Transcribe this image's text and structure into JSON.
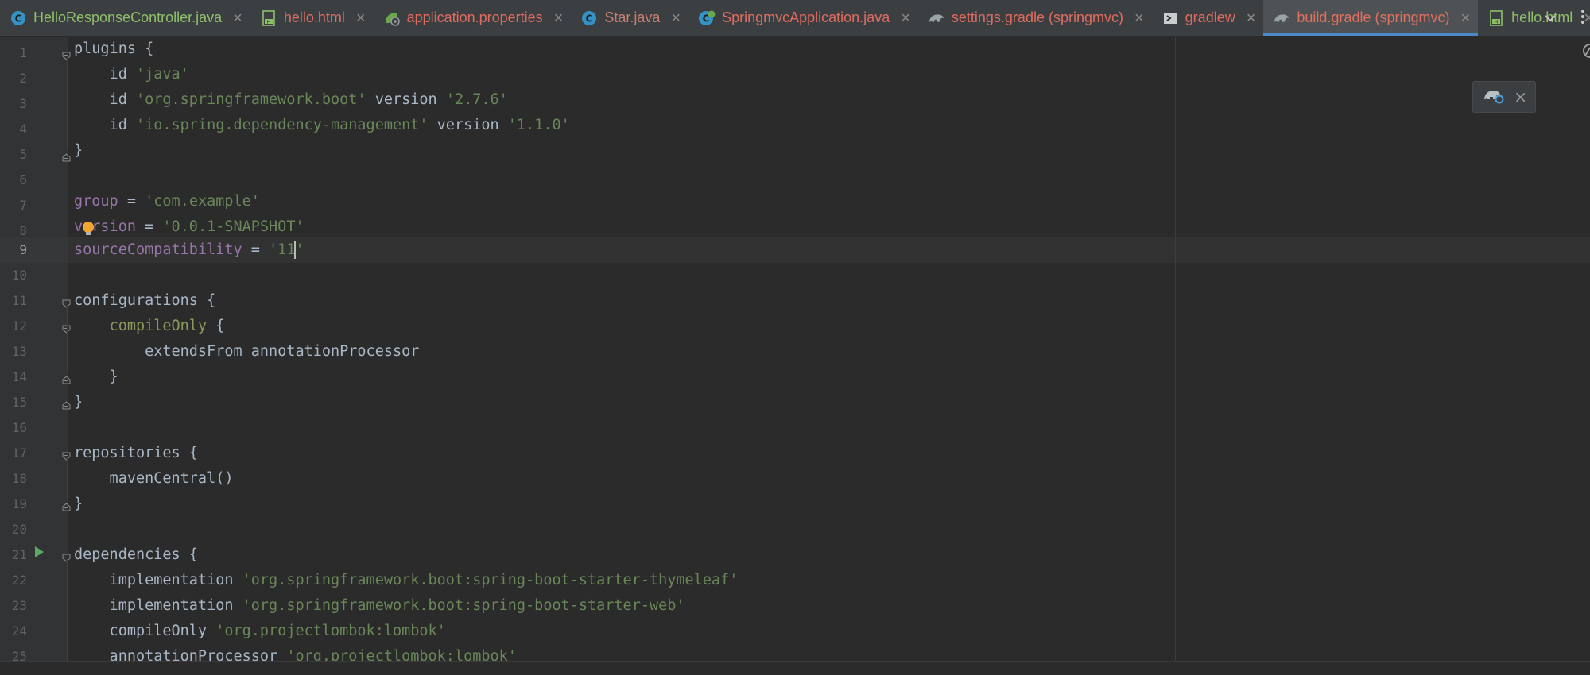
{
  "tabs": [
    {
      "label": "HelloResponseController.java",
      "icon": "java-class-icon",
      "color": "green"
    },
    {
      "label": "hello.html",
      "icon": "html-file-icon",
      "color": "red"
    },
    {
      "label": "application.properties",
      "icon": "spring-properties-icon",
      "color": "red"
    },
    {
      "label": "Star.java",
      "icon": "java-class-icon",
      "color": "blue"
    },
    {
      "label": "SpringmvcApplication.java",
      "icon": "spring-boot-class-icon",
      "color": "red"
    },
    {
      "label": "settings.gradle (springmvc)",
      "icon": "gradle-icon",
      "color": "red"
    },
    {
      "label": "gradlew",
      "icon": "shell-script-icon",
      "color": "red"
    },
    {
      "label": "build.gradle (springmvc)",
      "icon": "gradle-icon",
      "color": "red",
      "active": true
    },
    {
      "label": "hello.html",
      "icon": "html-file-icon",
      "color": "green"
    }
  ],
  "editor": {
    "current_line": 9,
    "lines": [
      {
        "n": "1"
      },
      {
        "n": "2"
      },
      {
        "n": "3"
      },
      {
        "n": "4"
      },
      {
        "n": "5"
      },
      {
        "n": "6"
      },
      {
        "n": "7"
      },
      {
        "n": "8"
      },
      {
        "n": "9"
      },
      {
        "n": "10"
      },
      {
        "n": "11"
      },
      {
        "n": "12"
      },
      {
        "n": "13"
      },
      {
        "n": "14"
      },
      {
        "n": "15"
      },
      {
        "n": "16"
      },
      {
        "n": "17"
      },
      {
        "n": "18"
      },
      {
        "n": "19"
      },
      {
        "n": "20"
      },
      {
        "n": "21"
      },
      {
        "n": "22"
      },
      {
        "n": "23"
      },
      {
        "n": "24"
      },
      {
        "n": "25"
      }
    ],
    "code": {
      "l1": {
        "a": "plugins {"
      },
      "l2": {
        "a": "    id ",
        "b": "'java'"
      },
      "l3": {
        "a": "    id ",
        "b": "'org.springframework.boot'",
        "c": " version ",
        "d": "'2.7.6'"
      },
      "l4": {
        "a": "    id ",
        "b": "'io.spring.dependency-management'",
        "c": " version ",
        "d": "'1.1.0'"
      },
      "l5": {
        "a": "}"
      },
      "l7": {
        "a": "group",
        "b": " = ",
        "c": "'com.example'"
      },
      "l8": {
        "a": "version",
        "b": " = ",
        "c": "'0.0.1-SNAPSHOT'"
      },
      "l9": {
        "a": "sourceCompatibility",
        "b": " = ",
        "c": "'11",
        "d": "'"
      },
      "l11": {
        "a": "configurations {"
      },
      "l12": {
        "a": "    ",
        "b": "compileOnly",
        "c": " {"
      },
      "l13": {
        "a": "        extendsFrom annotationProcessor"
      },
      "l14": {
        "a": "    }"
      },
      "l15": {
        "a": "}"
      },
      "l17": {
        "a": "repositories {"
      },
      "l18": {
        "a": "    mavenCentral()"
      },
      "l19": {
        "a": "}"
      },
      "l21": {
        "a": "dependencies {"
      },
      "l22": {
        "a": "    implementation ",
        "b": "'org.springframework.boot:spring-boot-starter-thymeleaf'"
      },
      "l23": {
        "a": "    implementation ",
        "b": "'org.springframework.boot:spring-boot-starter-web'"
      },
      "l24": {
        "a": "    compileOnly ",
        "b": "'org.projectlombok:lombok'"
      },
      "l25": {
        "a": "    annotationProcessor ",
        "b": "'org.projectlombok:lombok'"
      }
    }
  },
  "colors": {
    "background": "#2b2b2b",
    "string": "#6a8759",
    "property": "#9876aa",
    "keyword": "#a9b7c6",
    "active_tab_underline": "#4a88c7"
  },
  "popup": {
    "icon": "gradle-reload-icon"
  }
}
